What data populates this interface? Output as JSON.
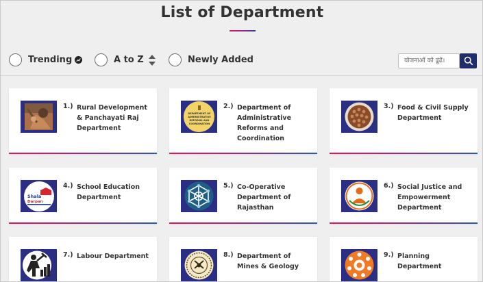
{
  "header": {
    "title": "List of Department"
  },
  "filters": {
    "trending_label": "Trending",
    "atoz_label": "A to Z",
    "newly_added_label": "Newly Added"
  },
  "search": {
    "placeholder": "योजनाओं को ढूंढें।"
  },
  "colors": {
    "accent_start": "#e7125e",
    "accent_end": "#2c5aa8",
    "thumb_bg": "#2b2f83",
    "search_button": "#1e2d6b"
  },
  "departments": [
    {
      "number": "1.)",
      "name": "Rural Development & Panchayati Raj Department",
      "icon": "rural-development-icon"
    },
    {
      "number": "2.)",
      "name": "Department of Administrative Reforms and Coordination",
      "icon": "administrative-reforms-seal-icon",
      "logo_text": "DEPARTMENT OF ADMINISTRATIVE REFORMS AND COORDINATION"
    },
    {
      "number": "3.)",
      "name": "Food & Civil Supply Department",
      "icon": "food-grains-icon"
    },
    {
      "number": "4.)",
      "name": "School Education Department",
      "icon": "shala-darpan-icon",
      "logo_text": "Shala Darpan"
    },
    {
      "number": "5.)",
      "name": "Co-Operative Department of Rajasthan",
      "icon": "cooperative-network-icon"
    },
    {
      "number": "6.)",
      "name": "Social Justice and Empowerment Department",
      "icon": "social-justice-emblem-icon"
    },
    {
      "number": "7.)",
      "name": "Labour Department",
      "icon": "labour-worker-icon"
    },
    {
      "number": "8.)",
      "name": "Department of Mines & Geology",
      "icon": "mines-geology-seal-icon"
    },
    {
      "number": "9.)",
      "name": "Planning Department",
      "icon": "planning-emblem-icon"
    }
  ]
}
